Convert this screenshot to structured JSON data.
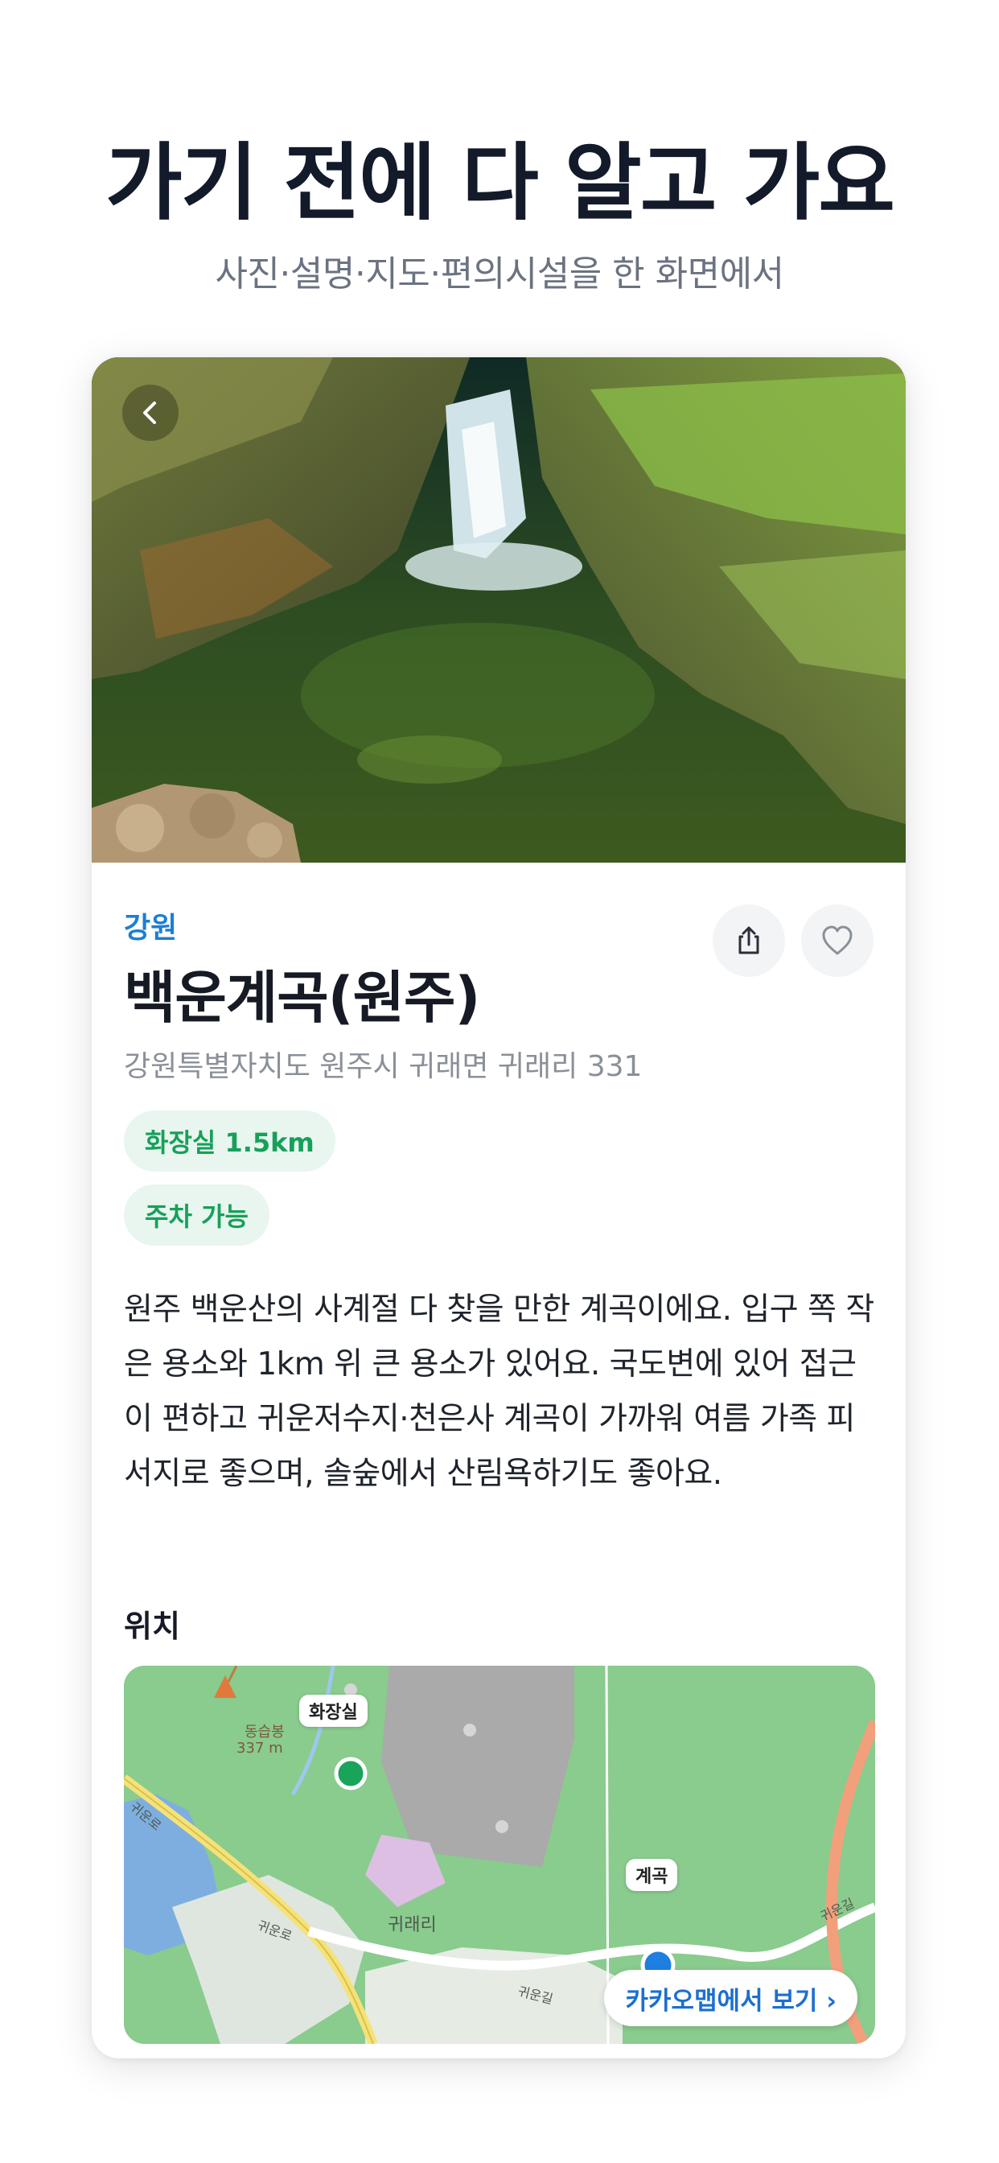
{
  "header": {
    "headline": "가기 전에 다 알고 가요",
    "subline": "사진·설명·지도·편의시설을 한 화면에서"
  },
  "place": {
    "region": "강원",
    "name": "백운계곡(원주)",
    "address": "강원특별자치도 원주시 귀래면 귀래리 331",
    "chips": [
      "화장실 1.5km",
      "주차 가능"
    ],
    "description": "원주 백운산의 사계절 다 찾을 만한 계곡이에요. 입구 쪽 작은 용소와 1km 위 큰 용소가 있어요. 국도변에 있어 접근이 편하고 귀운저수지·천은사 계곡이 가까워 여름 가족 피서지로 좋으며, 솔숲에서 산림욕하기도 좋아요."
  },
  "location": {
    "label": "위치",
    "map_labels": {
      "toilet": "화장실",
      "valley": "계곡",
      "peak_name": "동습봉",
      "peak_height": "337 m",
      "village": "귀래리",
      "road1": "귀운로",
      "road2": "귀운로",
      "road3": "귀운길",
      "road4": "귀운길"
    },
    "kakao_button": "카카오맵에서 보기 ›"
  },
  "icons": {
    "back": "chevron-left-icon",
    "share": "share-icon",
    "favorite": "heart-icon",
    "toilet_marker": "green-pin-icon",
    "valley_marker": "blue-pin-icon"
  },
  "colors": {
    "accent_blue": "#1d7fd2",
    "chip_green": "#17a05a",
    "chip_bg": "#e8f6ef",
    "map_green": "#86c98c",
    "kakao_blue": "#1c6fd1"
  }
}
